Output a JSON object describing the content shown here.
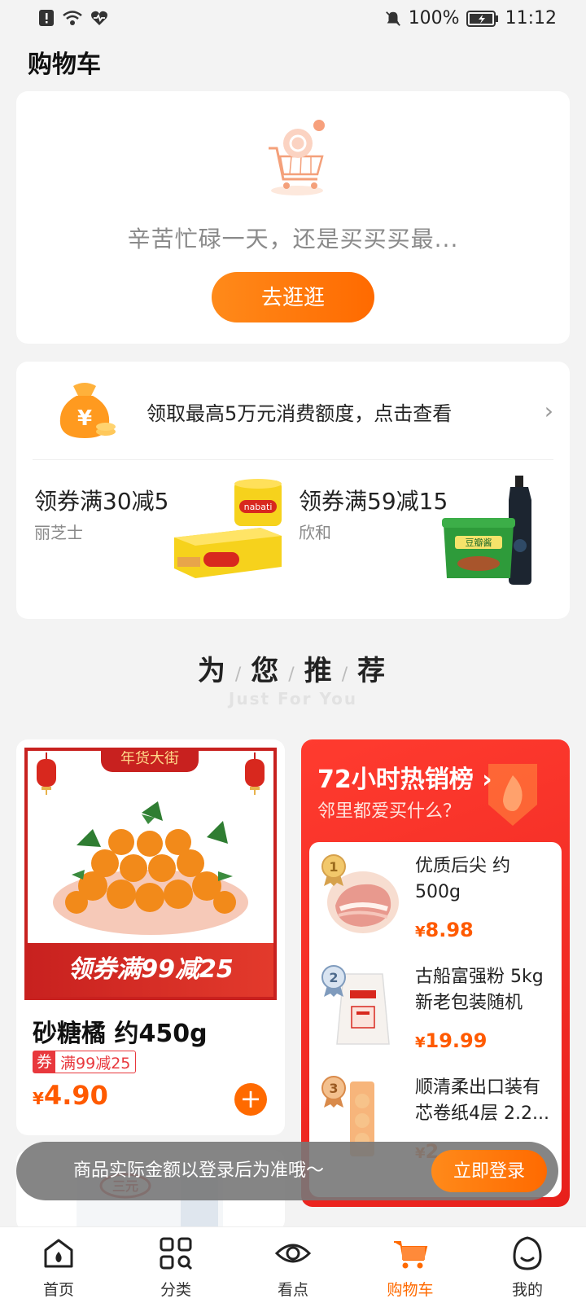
{
  "status_bar": {
    "battery": "100%",
    "time": "11:12"
  },
  "page_title": "购物车",
  "empty_cart": {
    "message": "辛苦忙碌一天，还是买买买最...",
    "go_button": "去逛逛"
  },
  "promo": {
    "credit_text": "领取最高5万元消费额度，点击查看",
    "coupons": [
      {
        "title": "领券满30减5",
        "brand": "丽芝士",
        "product_label": "nabati"
      },
      {
        "title": "领券满59减15",
        "brand": "欣和",
        "product_label": "豆瓣酱"
      }
    ]
  },
  "recommend": {
    "title_chars": [
      "为",
      "您",
      "推",
      "荐"
    ],
    "subtitle": "Just For You"
  },
  "product": {
    "top_tag": "年货大街",
    "banner": "领券满99减25",
    "name": "砂糖橘 约450g",
    "coupon_badge": "券",
    "coupon_text": "满99减25",
    "currency": "¥",
    "price": "4.90",
    "add_symbol": "+"
  },
  "hot_list": {
    "title": "72小时热销榜 ›",
    "subtitle": "邻里都爱买什么？",
    "items": [
      {
        "rank": "1",
        "name": "优质后尖 约500g",
        "currency": "¥",
        "price": "8.98"
      },
      {
        "rank": "2",
        "name": "古船富强粉 5kg新老包装随机",
        "currency": "¥",
        "price": "19.99"
      },
      {
        "rank": "3",
        "name": "顺清柔出口装有芯卷纸4层 2.2...",
        "currency": "¥",
        "price": "2"
      }
    ]
  },
  "next_product": {
    "brand_logo_text": "三元"
  },
  "toast": {
    "text": "商品实际金额以登录后为准哦～",
    "login_button": "立即登录"
  },
  "nav": [
    {
      "label": "首页",
      "icon": "home-icon"
    },
    {
      "label": "分类",
      "icon": "category-icon"
    },
    {
      "label": "看点",
      "icon": "eye-icon"
    },
    {
      "label": "购物车",
      "icon": "cart-icon",
      "active": true
    },
    {
      "label": "我的",
      "icon": "profile-icon"
    }
  ],
  "colors": {
    "accent": "#ff6a00",
    "hot_red": "#e7201c",
    "price": "#ff5a00"
  }
}
